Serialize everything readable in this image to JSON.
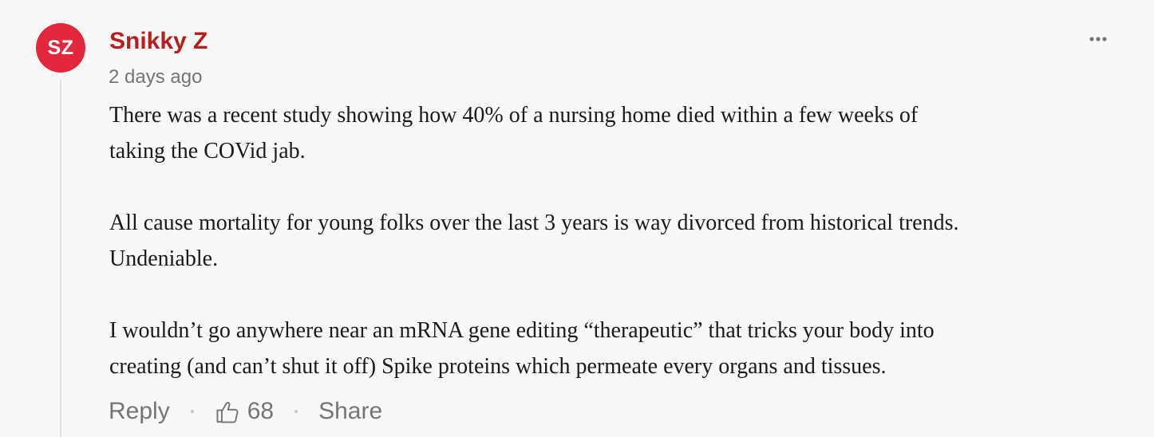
{
  "comment": {
    "avatar_initials": "SZ",
    "author": "Snikky Z",
    "timestamp": "2 days ago",
    "paragraphs": [
      "There was a recent study showing how 40% of a nursing home died within a few weeks of\ntaking the COVid jab.",
      "All cause mortality for young folks over the last 3 years is way divorced from historical trends.\nUndeniable.",
      "I wouldn’t go anywhere near an mRNA gene editing “therapeutic” that tricks your body into\ncreating (and can’t shut it off) Spike proteins which permeate every organs and tissues."
    ],
    "actions": {
      "reply_label": "Reply",
      "like_count": "68",
      "share_label": "Share"
    },
    "icons": {
      "more": "more-options-icon",
      "like": "thumbs-up-icon"
    }
  },
  "colors": {
    "background": "#f7f7f7",
    "avatar_bg": "#e3283e",
    "author_name": "#b51f1f",
    "muted_text": "#757575",
    "body_text": "#1a1a1a",
    "thread_line": "#e1e1e1"
  }
}
